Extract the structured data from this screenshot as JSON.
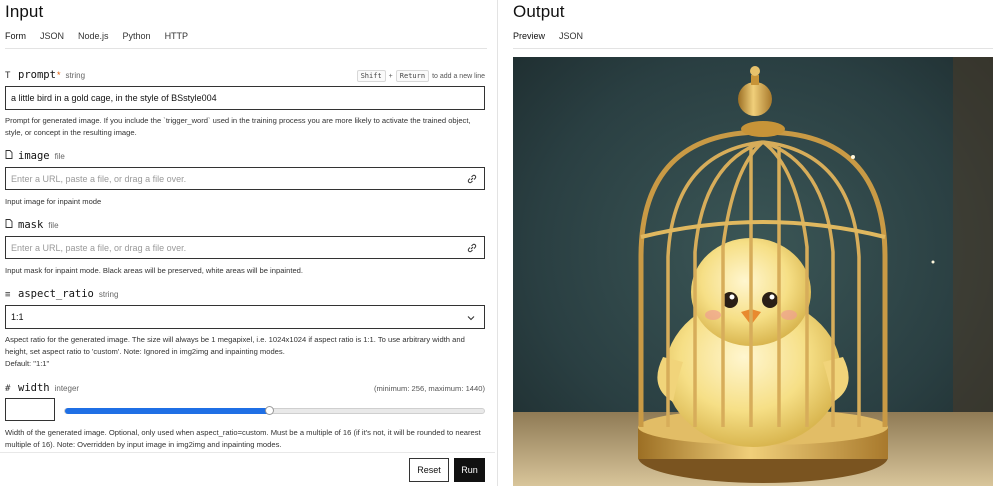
{
  "input_pane": {
    "title": "Input",
    "tabs": [
      "Form",
      "JSON",
      "Node.js",
      "Python",
      "HTTP"
    ],
    "active_tab": "Form"
  },
  "output_pane": {
    "title": "Output",
    "tabs": [
      "Preview",
      "JSON"
    ],
    "active_tab": "Preview"
  },
  "fields": {
    "prompt": {
      "icon": "text-icon",
      "icon_glyph": "T",
      "name": "prompt",
      "required_mark": "*",
      "type": "string",
      "hint_key1": "Shift",
      "hint_plus": "+",
      "hint_key2": "Return",
      "hint_text": "to add a new line",
      "value": "a little bird in a gold cage, in the style of BSstyle004",
      "description": "Prompt for generated image. If you include the `trigger_word` used in the training process you are more likely to activate the trained object, style, or concept in the resulting image."
    },
    "image": {
      "icon": "file-icon",
      "name": "image",
      "type": "file",
      "placeholder": "Enter a URL, paste a file, or drag a file over.",
      "description": "Input image for inpaint mode"
    },
    "mask": {
      "icon": "file-icon",
      "name": "mask",
      "type": "file",
      "placeholder": "Enter a URL, paste a file, or drag a file over.",
      "description": "Input mask for inpaint mode. Black areas will be preserved, white areas will be inpainted."
    },
    "aspect_ratio": {
      "icon": "list-icon",
      "icon_glyph": "≡",
      "name": "aspect_ratio",
      "type": "string",
      "value": "1:1",
      "description": "Aspect ratio for the generated image. The size will always be 1 megapixel, i.e. 1024x1024 if aspect ratio is 1:1. To use arbitrary width and height, set aspect ratio to 'custom'. Note: Ignored in img2img and inpainting modes.",
      "default": "Default: \"1:1\""
    },
    "width": {
      "icon": "hash-icon",
      "icon_glyph": "#",
      "name": "width",
      "type": "integer",
      "range": "(minimum: 256, maximum: 1440)",
      "value": "",
      "slider_fraction": 0.49,
      "description": "Width of the generated image. Optional, only used when aspect_ratio=custom. Must be a multiple of 16 (if it's not, it will be rounded to nearest multiple of 16). Note: Overridden by input image in img2img and inpainting modes."
    }
  },
  "actions": {
    "reset": "Reset",
    "run": "Run"
  },
  "colors": {
    "accent": "#1f6fe5",
    "run_bg": "#111111",
    "required": "#e05a00"
  }
}
